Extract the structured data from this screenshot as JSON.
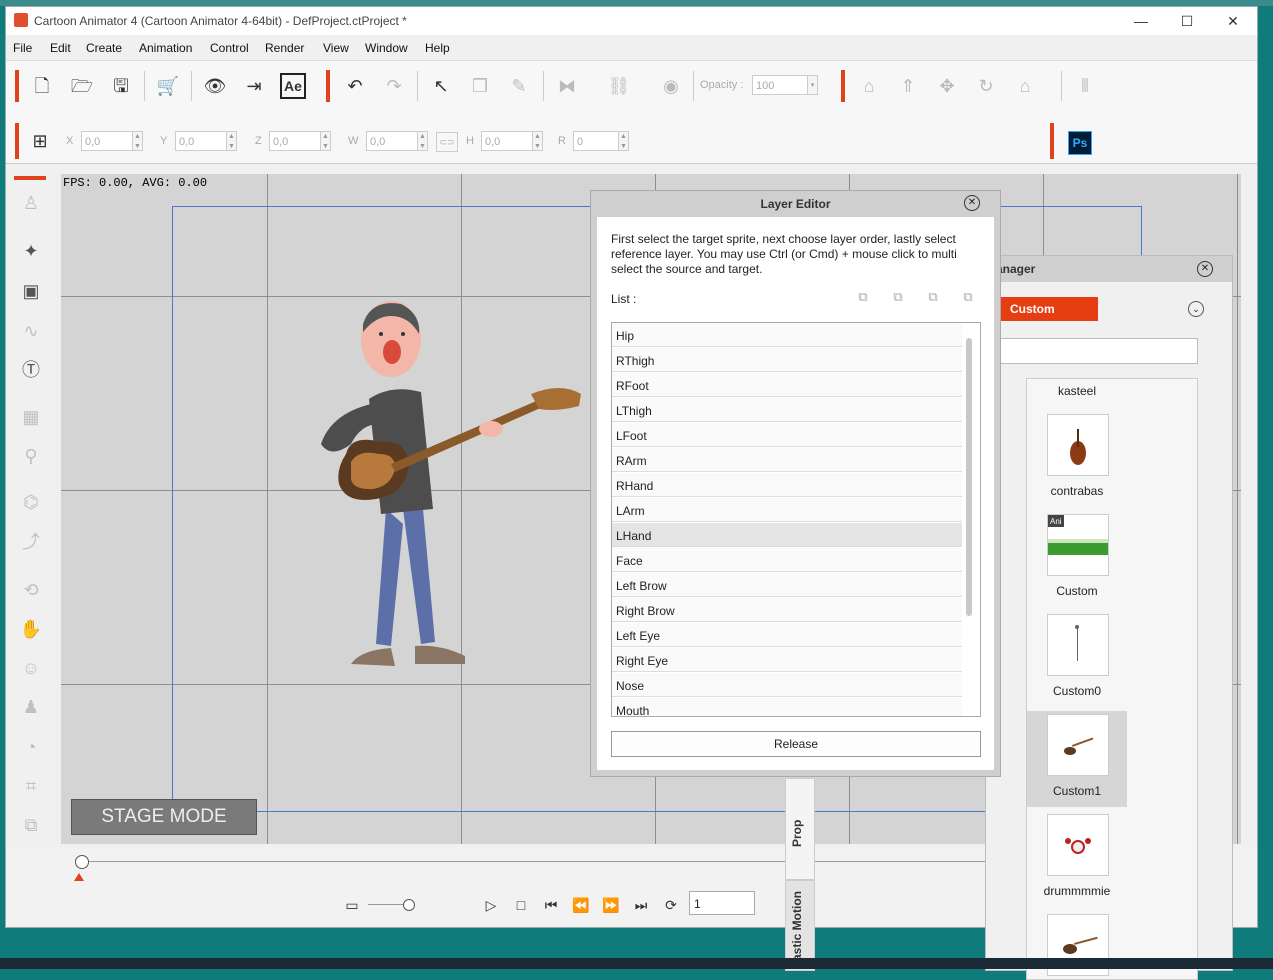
{
  "window": {
    "title": "Cartoon Animator 4  (Cartoon Animator 4-64bit) - DefProject.ctProject *",
    "controls": [
      "—",
      "☐",
      "✕"
    ]
  },
  "menu": [
    "File",
    "Edit",
    "Create",
    "Animation",
    "Control",
    "Render",
    "View",
    "Window",
    "Help"
  ],
  "toolbar": {
    "ae_label": "Ae",
    "opacity_label": "Opacity :",
    "opacity_value": "100",
    "ps_label": "Ps"
  },
  "transform": {
    "fields": [
      {
        "label": "X",
        "value": "0,0"
      },
      {
        "label": "Y",
        "value": "0,0"
      },
      {
        "label": "Z",
        "value": "0,0"
      },
      {
        "label": "W",
        "value": "0,0"
      },
      {
        "label": "H",
        "value": "0,0"
      },
      {
        "label": "R",
        "value": "0"
      }
    ]
  },
  "stage": {
    "fps_text": "FPS: 0.00, AVG: 0.00",
    "mode_label": "STAGE MODE"
  },
  "timeline": {
    "frame_value": "1"
  },
  "layer_editor": {
    "title": "Layer Editor",
    "description": "First select the target sprite, next choose layer order, lastly select reference layer. You may use Ctrl (or Cmd) + mouse click to multi select the source and target.",
    "list_label": "List :",
    "layers": [
      "Hip",
      "RThigh",
      "RFoot",
      "LThigh",
      "LFoot",
      "RArm",
      "RHand",
      "LArm",
      "LHand",
      "Face",
      "Left Brow",
      "Right Brow",
      "Left Eye",
      "Right Eye",
      "Nose",
      "Mouth"
    ],
    "selected_layer": "LHand",
    "release_label": "Release"
  },
  "content_manager": {
    "title": "anager",
    "tab": "Custom",
    "items": [
      "kasteel",
      "contrabas",
      "Custom",
      "Custom0",
      "Custom1",
      "drummmmie"
    ],
    "selected_item": "Custom1",
    "vertical_tabs": [
      "Prop",
      "astic Motion"
    ]
  },
  "colors": {
    "accent": "#e0421d",
    "stage_bg": "#d4d4d4",
    "desktop": "#0f7b7b"
  }
}
